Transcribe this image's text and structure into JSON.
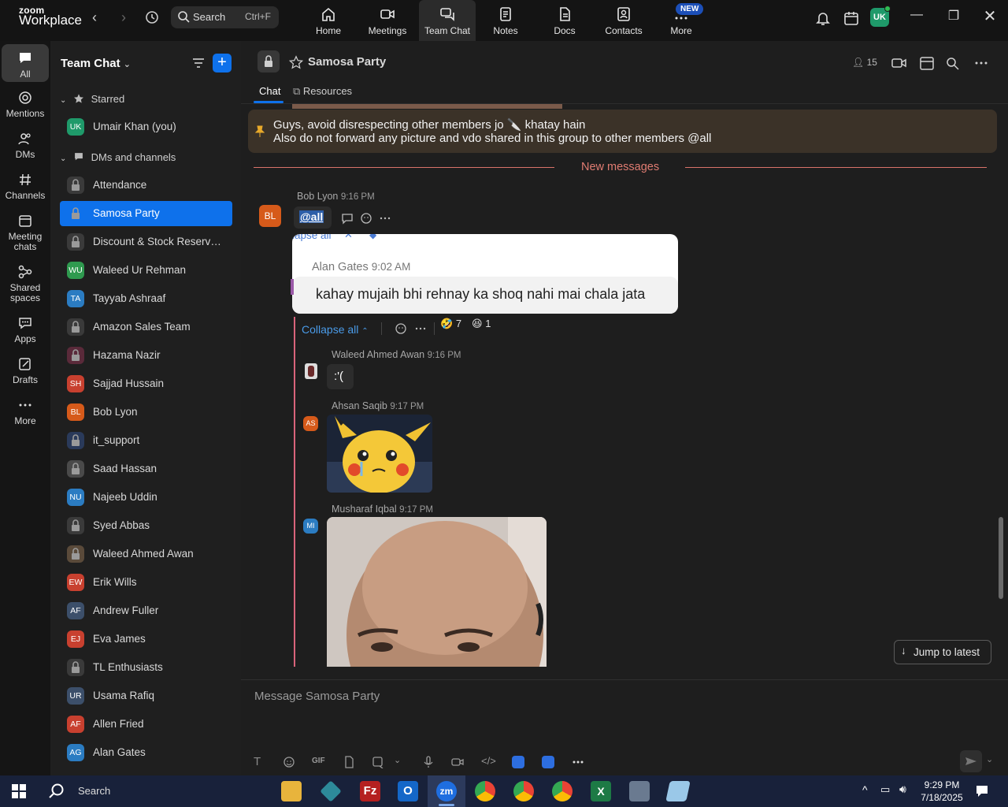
{
  "app": {
    "logo_small": "zoom",
    "logo_big": "Workplace"
  },
  "search": {
    "label": "Search",
    "shortcut": "Ctrl+F"
  },
  "topnav": [
    {
      "label": "Home",
      "icon": "home-icon"
    },
    {
      "label": "Meetings",
      "icon": "video-icon"
    },
    {
      "label": "Team Chat",
      "icon": "chat-icon"
    },
    {
      "label": "Notes",
      "icon": "notes-icon"
    },
    {
      "label": "Docs",
      "icon": "docs-icon"
    },
    {
      "label": "Contacts",
      "icon": "contacts-icon"
    },
    {
      "label": "More",
      "icon": "more-icon"
    }
  ],
  "new_badge": "NEW",
  "user_avatar": "UK",
  "rail": [
    {
      "label": "All"
    },
    {
      "label": "Mentions"
    },
    {
      "label": "DMs"
    },
    {
      "label": "Channels"
    },
    {
      "label": "Meeting chats"
    },
    {
      "label": "Shared spaces"
    },
    {
      "label": "Apps"
    },
    {
      "label": "Drafts"
    },
    {
      "label": "More"
    }
  ],
  "sidebar": {
    "title": "Team Chat",
    "starred_label": "Starred",
    "dms_label": "DMs and channels",
    "starred": [
      {
        "label": "Umair Khan (you)",
        "initials": "UK",
        "color": "#1f9a6a"
      }
    ],
    "items": [
      {
        "label": "Attendance",
        "initials": "",
        "color": "#3a3a3a"
      },
      {
        "label": "Samosa Party",
        "initials": "",
        "color": "#3a3a3a"
      },
      {
        "label": "Discount & Stock Reservati...",
        "initials": "",
        "color": "#3a3a3a"
      },
      {
        "label": "Waleed Ur Rehman",
        "initials": "WU",
        "color": "#2f9a4f"
      },
      {
        "label": "Tayyab Ashraaf",
        "initials": "TA",
        "color": "#2b7cc2"
      },
      {
        "label": "Amazon Sales Team",
        "initials": "",
        "color": "#3a3a3a"
      },
      {
        "label": "Hazama Nazir",
        "initials": "",
        "color": "#5a2a3a"
      },
      {
        "label": "Sajjad Hussain",
        "initials": "SH",
        "color": "#c8402f"
      },
      {
        "label": "Bob Lyon",
        "initials": "BL",
        "color": "#d65a1a"
      },
      {
        "label": "it_support",
        "initials": "",
        "color": "#2a3a5a"
      },
      {
        "label": "Saad Hassan",
        "initials": "",
        "color": "#4a4a4a"
      },
      {
        "label": "Najeeb Uddin",
        "initials": "NU",
        "color": "#2b7cc2"
      },
      {
        "label": "Syed Abbas",
        "initials": "",
        "color": "#3a3a3a"
      },
      {
        "label": "Waleed Ahmed Awan",
        "initials": "",
        "color": "#5a4a3a"
      },
      {
        "label": "Erik Wills",
        "initials": "EW",
        "color": "#c8402f"
      },
      {
        "label": "Andrew Fuller",
        "initials": "AF",
        "color": "#3c4f6a"
      },
      {
        "label": "Eva James",
        "initials": "EJ",
        "color": "#c8402f"
      },
      {
        "label": "TL Enthusiasts",
        "initials": "",
        "color": "#3a3a3a"
      },
      {
        "label": "Usama Rafiq",
        "initials": "UR",
        "color": "#3c4f6a"
      },
      {
        "label": "Allen Fried",
        "initials": "AF",
        "color": "#c8402f"
      },
      {
        "label": "Alan Gates",
        "initials": "AG",
        "color": "#2b7cc2"
      }
    ]
  },
  "channel": {
    "name": "Samosa Party",
    "member_count": "15",
    "tabs": [
      "Chat",
      "Resources"
    ]
  },
  "pinned": {
    "line1": "Guys, avoid disrespecting other members jo 🔪 khatay hain",
    "line2": "Also do not forward any picture and vdo shared in this group to other members @all"
  },
  "new_messages_label": "New messages",
  "messages": {
    "main": {
      "author": "Bob Lyon",
      "time": "9:16 PM",
      "initials": "BL",
      "text": "@all",
      "color": "#d65a1a"
    },
    "quote": {
      "collapse_partial": "lapse all",
      "author": "Alan Gates",
      "time": "9:02 AM",
      "text": "kahay mujaih bhi rehnay ka shoq nahi mai chala jata"
    },
    "collapse_label": "Collapse all",
    "reactions": [
      {
        "emoji": "🤣",
        "count": "7"
      },
      {
        "emoji": "😆",
        "count": "1"
      }
    ],
    "replies": [
      {
        "author": "Waleed Ahmed Awan",
        "time": "9:16 PM",
        "text": ":'("
      },
      {
        "author": "Ahsan Saqib",
        "time": "9:17 PM",
        "initials": "AS",
        "color": "#d65a1a"
      },
      {
        "author": "Musharaf Iqbal",
        "time": "9:17 PM",
        "initials": "MI",
        "color": "#2b7cc2"
      }
    ]
  },
  "jump_label": "Jump to latest",
  "composer": {
    "placeholder": "Message Samosa Party",
    "gif": "GIF"
  },
  "taskbar": {
    "search": "Search",
    "time": "9:29 PM",
    "date": "7/18/2025"
  }
}
